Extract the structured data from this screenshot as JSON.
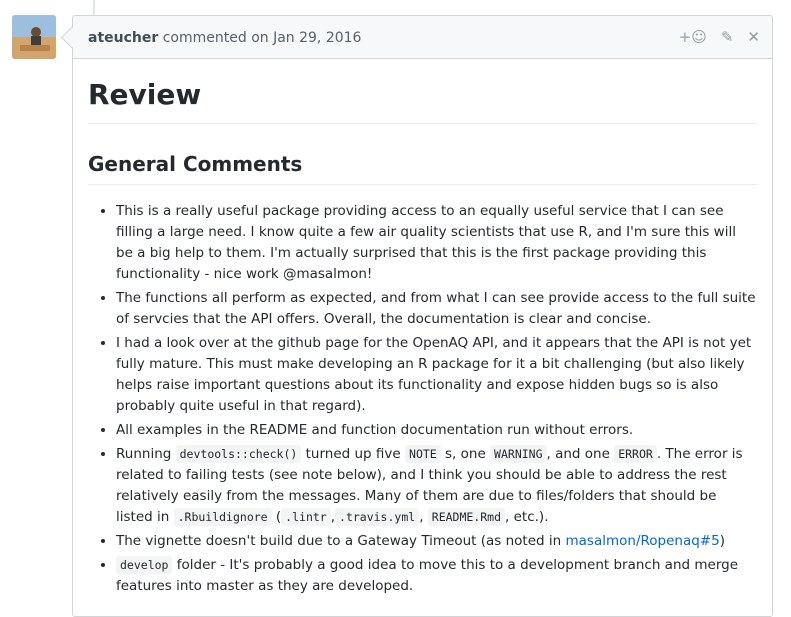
{
  "comment": {
    "author": "ateucher",
    "meta": "commented on Jan 29, 2016",
    "actions": {
      "reaction_icon": "+☺",
      "edit_icon": "✎",
      "close_icon": "✕"
    }
  },
  "content": {
    "h1": "Review",
    "h2": "General Comments",
    "items": [
      {
        "text": "This is a really useful package providing access to an equally useful service that I can see filling a large need. I know quite a few air quality scientists that use R, and I'm sure this will be a big help to them. I'm actually surprised that this is the first package providing this functionality - nice work @masalmon!"
      },
      {
        "text": "The functions all perform as expected, and from what I can see provide access to the full suite of servcies that the API offers. Overall, the documentation is clear and concise."
      },
      {
        "text": "I had a look over at the github page for the OpenAQ API, and it appears that the API is not yet fully mature. This must make developing an R package for it a bit challenging (but also likely helps raise important questions about its functionality and expose hidden bugs so is also probably quite useful in that regard)."
      },
      {
        "text": "All examples in the README and function documentation run without errors."
      },
      {
        "t1": "Running ",
        "c1": "devtools::check()",
        "t2": " turned up five ",
        "c2": "NOTE",
        "t3": " s, one ",
        "c3": "WARNING",
        "t4": ", and one ",
        "c4": "ERROR",
        "t5": ". The error is related to failing tests (see note below), and I think you should be able to address the rest relatively easily from the messages. Many of them are due to files/folders that should be listed in ",
        "c5": ".Rbuildignore",
        "t6": " (",
        "c6": ".lintr",
        "t7": ",",
        "c7": ".travis.yml",
        "t8": ", ",
        "c8": "README.Rmd",
        "t9": ", etc.)."
      },
      {
        "t1": "The vignette doesn't build due to a Gateway Timeout (as noted in ",
        "link": "masalmon/Ropenaq#5",
        "t2": ")"
      },
      {
        "c1": "develop",
        "t1": " folder - It's probably a good idea to move this to a development branch and merge features into master as they are developed."
      }
    ]
  }
}
